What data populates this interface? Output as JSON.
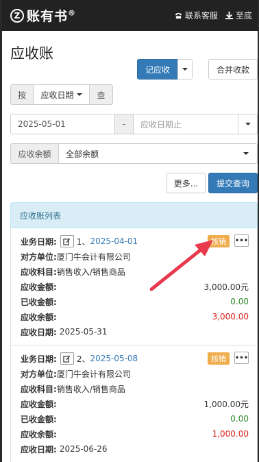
{
  "header": {
    "brand_logo": "Z",
    "brand_name": "账有书",
    "brand_reg": "®",
    "service_label": "联系客服",
    "bottom_label": "至底"
  },
  "page_title": "应收账",
  "actions": {
    "record_label": "记应收",
    "merge_label": "合并收款"
  },
  "sort": {
    "by_label": "按",
    "field_label": "应收日期",
    "search_label": "查"
  },
  "date_range": {
    "start_value": "2025-05-01",
    "separator": "-",
    "end_placeholder": "应收日期止"
  },
  "balance_filter": {
    "label": "应收余额",
    "selected": "全部余额"
  },
  "buttons": {
    "more_label": "更多...",
    "submit_label": "提交查询"
  },
  "list_title": "应收账列表",
  "labels": {
    "biz_date": "业务日期:",
    "counterparty": "对方单位:",
    "subject": "应收科目:",
    "amount": "应收金额:",
    "received": "已收金额:",
    "balance": "应收余额:",
    "due_date": "应收日期:",
    "writeoff": "核销",
    "more_dots": "•••"
  },
  "records": [
    {
      "index": "1、",
      "biz_date": "2025-04-01",
      "counterparty": "厦门牛会计有限公司",
      "subject": "销售收入/销售商品",
      "amount": "3,000.00元",
      "received": "0.00",
      "balance": "3,000.00",
      "due_date": "2025-05-31"
    },
    {
      "index": "2、",
      "biz_date": "2025-05-08",
      "counterparty": "厦门牛会计有限公司",
      "subject": "销售收入/销售商品",
      "amount": "1,000.00元",
      "received": "0.00",
      "balance": "1,000.00",
      "due_date": "2025-06-26"
    }
  ],
  "colors": {
    "primary": "#337ab7",
    "badge": "#f0ad4e",
    "received": "#2a8a2a",
    "balance": "#d9201c",
    "arrow": "#e8394d"
  }
}
